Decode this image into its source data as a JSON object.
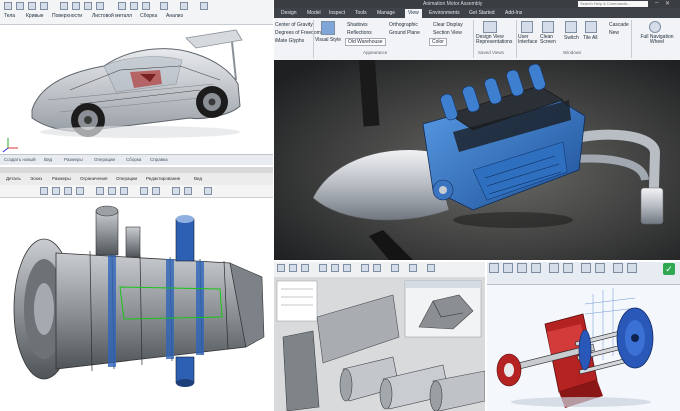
{
  "panel_car": {
    "tabs": [
      "Тела",
      "Кривые",
      "Поверхности",
      "Листовой металл",
      "Сборка",
      "Анализ"
    ],
    "status": [
      "Создать новый",
      "Вид",
      "Размеры",
      "Операции",
      "Сборка",
      "Справка"
    ]
  },
  "panel_engine": {
    "window_title": "Animation Motor Assembly",
    "search_placeholder": "Search Help & Commands...",
    "menu": [
      "Design",
      "Model",
      "Inspect",
      "Tools",
      "Manage",
      "View",
      "Environments",
      "Get Started",
      "Add-Ins"
    ],
    "active_menu": "View",
    "ribbon_left": [
      "Center of Gravity",
      "Degrees of Freedom",
      "iMate Glyphs"
    ],
    "ribbon_visual": [
      "Visual Style",
      "Shadows",
      "Reflections",
      "Old Warehouse",
      "Orthographic",
      "Ground Plane",
      "Color",
      "Clear Display",
      "Section View"
    ],
    "ribbon_views": [
      "Design View Representations"
    ],
    "ribbon_windows": [
      "User Interface",
      "Clean Screen",
      "Switch",
      "Tile All",
      "Cascade",
      "New",
      "Full Navigation Wheel"
    ],
    "groups": [
      "Appearance",
      "Saved Views",
      "Windows"
    ]
  },
  "panel_turbine": {
    "toolbar": [
      "Деталь",
      "Эскиз",
      "Размеры",
      "Ограничения",
      "Операции",
      "Редактирование",
      "Вид"
    ]
  },
  "panel_part": {},
  "panel_pump": {},
  "colors": {
    "accent": "#1f6fc4",
    "ribbon": "#f1f3f6",
    "dark_title": "#3a3d42"
  }
}
